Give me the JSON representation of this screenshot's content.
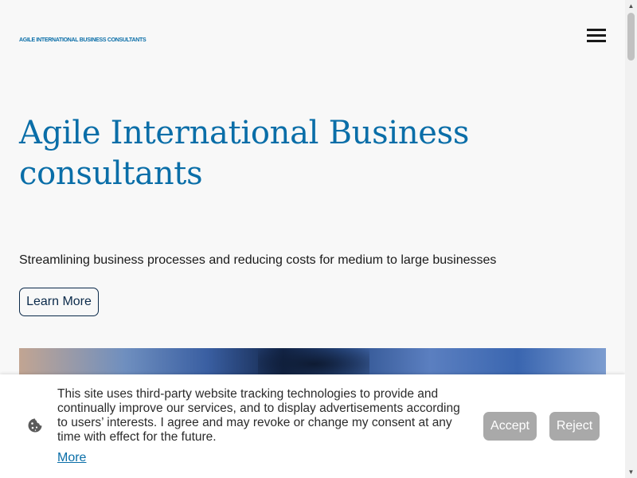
{
  "header": {
    "brand": "AGILE INTERNATIONAL BUSINESS CONSULTANTS",
    "menu_icon": "hamburger-menu-icon"
  },
  "hero": {
    "title": "Agile International Business consultants",
    "subtitle": "Streamlining business processes and reducing costs for medium to large businesses",
    "cta_label": "Learn More"
  },
  "cookie": {
    "icon": "cookie-icon",
    "text": "This site uses third-party website tracking technologies to provide and continually improve our services, and to display advertisements according to users’ interests. I agree and may revoke or change my consent at any time with effect for the future.",
    "more_label": "More",
    "accept_label": "Accept",
    "reject_label": "Reject"
  },
  "colors": {
    "accent": "#0a6ea8",
    "button_border": "#0b2a4a",
    "consent_button": "#a9a9a9",
    "background": "#f8f8f8"
  }
}
